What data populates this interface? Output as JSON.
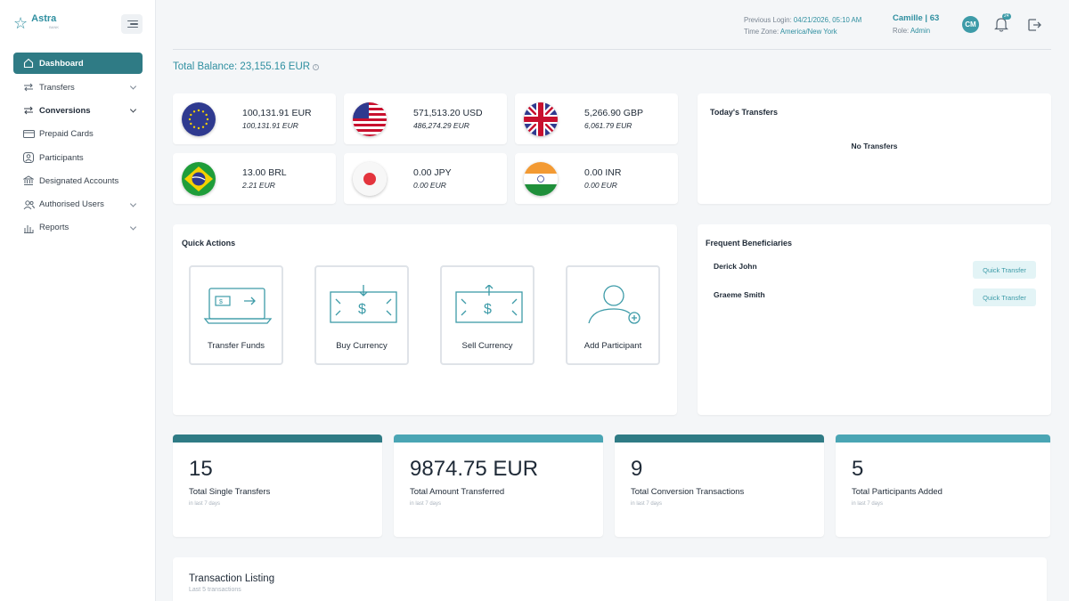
{
  "sidebar": {
    "logo": {
      "name": "Astra",
      "sub": "BANK"
    },
    "items": [
      {
        "label": "Dashboard",
        "icon": "home-icon"
      },
      {
        "label": "Transfers",
        "icon": "arrows-icon"
      },
      {
        "label": "Conversions",
        "icon": "conversion-icon"
      },
      {
        "label": "Prepaid Cards",
        "icon": "card-icon"
      },
      {
        "label": "Participants",
        "icon": "participant-icon"
      },
      {
        "label": "Designated Accounts",
        "icon": "bank-icon"
      },
      {
        "label": "Authorised Users",
        "icon": "users-icon"
      },
      {
        "label": "Reports",
        "icon": "chart-icon"
      }
    ]
  },
  "header": {
    "prev_login_label": "Previous Login:",
    "prev_login_value": "04/21/2026, 05:10 AM",
    "timezone_label": "Time Zone:",
    "timezone_value": "America/New York",
    "user_name": "Camille | 63",
    "role_label": "Role:",
    "role_value": "Admin",
    "avatar": "CM",
    "notification_count": "24"
  },
  "total_balance": "Total Balance: 23,155.16 EUR",
  "info_mark": "i",
  "currencies": [
    {
      "amount": "100,131.91 EUR",
      "eur": "100,131.91 EUR",
      "flag": "eu"
    },
    {
      "amount": "571,513.20 USD",
      "eur": "486,274.29 EUR",
      "flag": "us"
    },
    {
      "amount": "5,266.90 GBP",
      "eur": "6,061.79 EUR",
      "flag": "gb"
    },
    {
      "amount": "13.00 BRL",
      "eur": "2.21 EUR",
      "flag": "br"
    },
    {
      "amount": "0.00 JPY",
      "eur": "0.00 EUR",
      "flag": "jp"
    },
    {
      "amount": "0.00 INR",
      "eur": "0.00 EUR",
      "flag": "in"
    }
  ],
  "todays_transfers": {
    "title": "Today's Transfers",
    "empty": "No Transfers"
  },
  "quick_actions": {
    "title": "Quick Actions",
    "items": [
      {
        "label": "Transfer Funds",
        "icon": "transfer-funds-icon"
      },
      {
        "label": "Buy Currency",
        "icon": "buy-currency-icon"
      },
      {
        "label": "Sell Currency",
        "icon": "sell-currency-icon"
      },
      {
        "label": "Add Participant",
        "icon": "add-participant-icon"
      }
    ]
  },
  "beneficiaries": {
    "title": "Frequent Beneficiaries",
    "button_label": "Quick Transfer",
    "items": [
      "Derick John",
      "Graeme Smith"
    ]
  },
  "stats": [
    {
      "value": "15",
      "label": "Total Single Transfers",
      "sub": "in last 7 days",
      "color": "#2f7b85"
    },
    {
      "value": "9874.75 EUR",
      "label": "Total Amount Transferred",
      "sub": "in last 7 days",
      "color": "#4aa5b4"
    },
    {
      "value": "9",
      "label": "Total Conversion Transactions",
      "sub": "in last 7 days",
      "color": "#2f7b85"
    },
    {
      "value": "5",
      "label": "Total Participants Added",
      "sub": "in last 7 days",
      "color": "#4aa5b4"
    }
  ],
  "transaction_listing": {
    "title": "Transaction Listing",
    "sub": "Last 5 transactions"
  },
  "colors": {
    "accent": "#2f8fa0",
    "active_nav": "#2f7b85",
    "light_accent": "#e3f4f6"
  }
}
